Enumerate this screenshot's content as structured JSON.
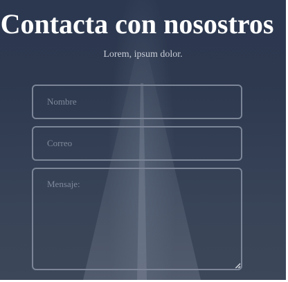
{
  "header": {
    "title": "Contacta con nosostros",
    "subtitle": "Lorem, ipsum dolor."
  },
  "form": {
    "name_placeholder": "Nombre",
    "email_placeholder": "Correo",
    "message_placeholder": "Mensaje:"
  },
  "colors": {
    "background": "#2e394f",
    "field_border": "#7c8698",
    "placeholder": "#7f899b",
    "title": "#ffffff"
  }
}
